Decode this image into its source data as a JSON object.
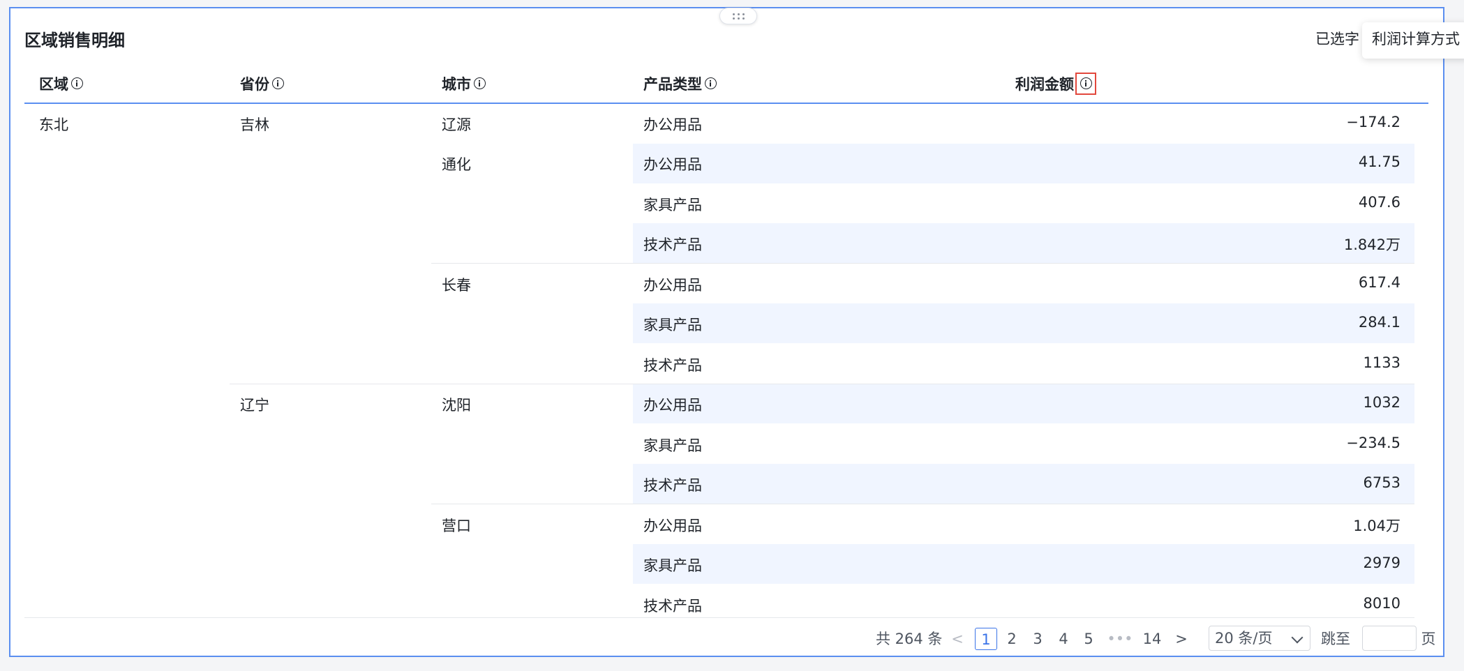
{
  "title": "区域销售明细",
  "selected_text": "已选字",
  "tooltip": "利润计算方式",
  "columns": [
    "区域",
    "省份",
    "城市",
    "产品类型",
    "利润金额"
  ],
  "region": "东北",
  "provinces": [
    "吉林",
    "辽宁"
  ],
  "cities": [
    "辽源",
    "通化",
    "长春",
    "沈阳",
    "营口"
  ],
  "rows": [
    {
      "type": "办公用品",
      "value": "−174.2"
    },
    {
      "type": "办公用品",
      "value": "41.75"
    },
    {
      "type": "家具产品",
      "value": "407.6"
    },
    {
      "type": "技术产品",
      "value": "1.842万"
    },
    {
      "type": "办公用品",
      "value": "617.4"
    },
    {
      "type": "家具产品",
      "value": "284.1"
    },
    {
      "type": "技术产品",
      "value": "1133"
    },
    {
      "type": "办公用品",
      "value": "1032"
    },
    {
      "type": "家具产品",
      "value": "−234.5"
    },
    {
      "type": "技术产品",
      "value": "6753"
    },
    {
      "type": "办公用品",
      "value": "1.04万"
    },
    {
      "type": "家具产品",
      "value": "2979"
    },
    {
      "type": "技术产品",
      "value": "8010"
    }
  ],
  "pagination": {
    "total": "共 264 条",
    "prev": "<",
    "pages": [
      "1",
      "2",
      "3",
      "4",
      "5"
    ],
    "ellipsis": "•••",
    "last": "14",
    "next": ">",
    "page_size": "20 条/页",
    "jump_label": "跳至",
    "page_unit": "页",
    "current": "1"
  }
}
